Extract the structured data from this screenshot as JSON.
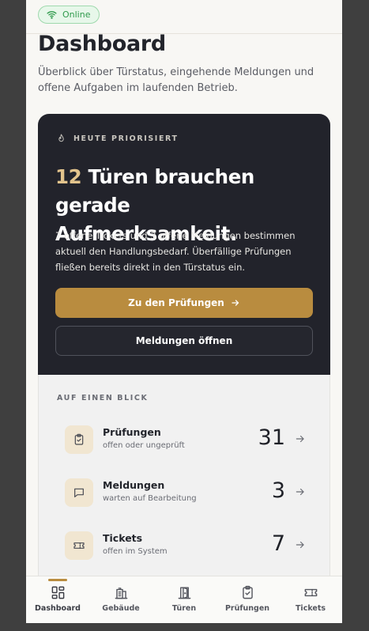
{
  "status": {
    "label": "Online",
    "color": "#2f9a4c"
  },
  "page": {
    "title": "Dashboard",
    "subtitle": "Überblick über Türstatus, eingehende Meldungen und offene Aufgaben im laufenden Betrieb."
  },
  "hero": {
    "eyebrow": "HEUTE PRIORISIERT",
    "count": "12",
    "headline": "Türen brauchen gerade Aufmerksamkeit.",
    "description": "7 offene Tickets und 3 offene Meldungen bestimmen aktuell den Handlungsbedarf. Überfällige Prüfungen fließen bereits direkt in den Türstatus ein.",
    "primary_button": "Zu den Prüfungen",
    "secondary_button": "Meldungen öffnen"
  },
  "overview": {
    "label": "AUF EINEN BLICK",
    "items": [
      {
        "name": "Prüfungen",
        "desc": "offen oder ungeprüft",
        "value": "31",
        "icon": "clipboard-check-icon"
      },
      {
        "name": "Meldungen",
        "desc": "warten auf Bearbeitung",
        "value": "3",
        "icon": "message-icon"
      },
      {
        "name": "Tickets",
        "desc": "offen im System",
        "value": "7",
        "icon": "ticket-icon"
      }
    ]
  },
  "nav": [
    {
      "label": "Dashboard",
      "icon": "grid-icon",
      "active": true
    },
    {
      "label": "Gebäude",
      "icon": "building-icon",
      "active": false
    },
    {
      "label": "Türen",
      "icon": "door-icon",
      "active": false
    },
    {
      "label": "Prüfungen",
      "icon": "clipboard-check-icon",
      "active": false
    },
    {
      "label": "Tickets",
      "icon": "ticket-icon",
      "active": false
    }
  ],
  "colors": {
    "accent": "#b98c3f",
    "hero_bg": "#22232b",
    "highlight": "#e2c38c"
  }
}
